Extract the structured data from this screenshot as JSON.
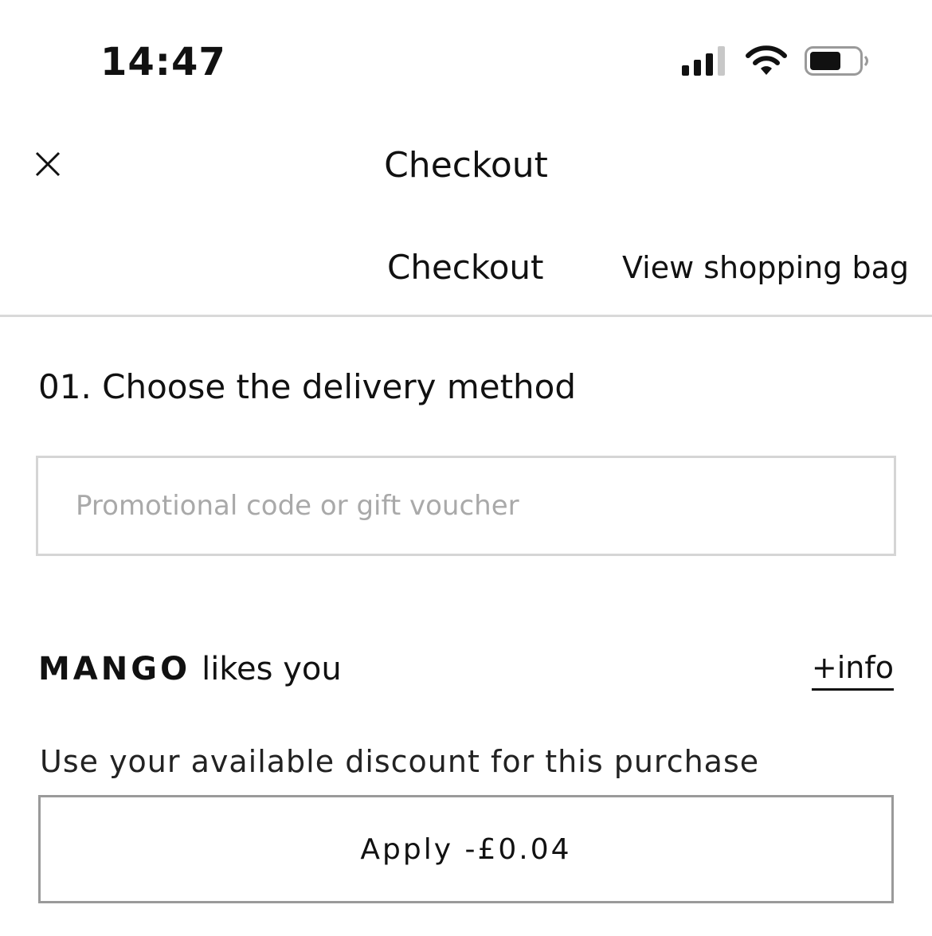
{
  "status_bar": {
    "time": "14:47",
    "icons": [
      "cellular-signal-icon",
      "wifi-icon",
      "battery-icon"
    ]
  },
  "header": {
    "close_icon": "close-icon",
    "title": "Checkout"
  },
  "tabs": [
    {
      "label": "Checkout"
    },
    {
      "label": "View shopping bag"
    }
  ],
  "delivery": {
    "heading": "01. Choose the delivery method"
  },
  "promo": {
    "placeholder": "Promotional code or gift voucher",
    "value": ""
  },
  "loyalty": {
    "brand": "MANGO",
    "brand_suffix": "likes you",
    "info_link": "+info",
    "description": "Use your available discount for this purchase",
    "apply_label": "Apply -£0.04"
  },
  "colors": {
    "text": "#111111",
    "divider": "#d9d9d9",
    "input_border": "#d5d5d5",
    "placeholder": "#a9a9a9",
    "button_border": "#9a9a9a"
  }
}
